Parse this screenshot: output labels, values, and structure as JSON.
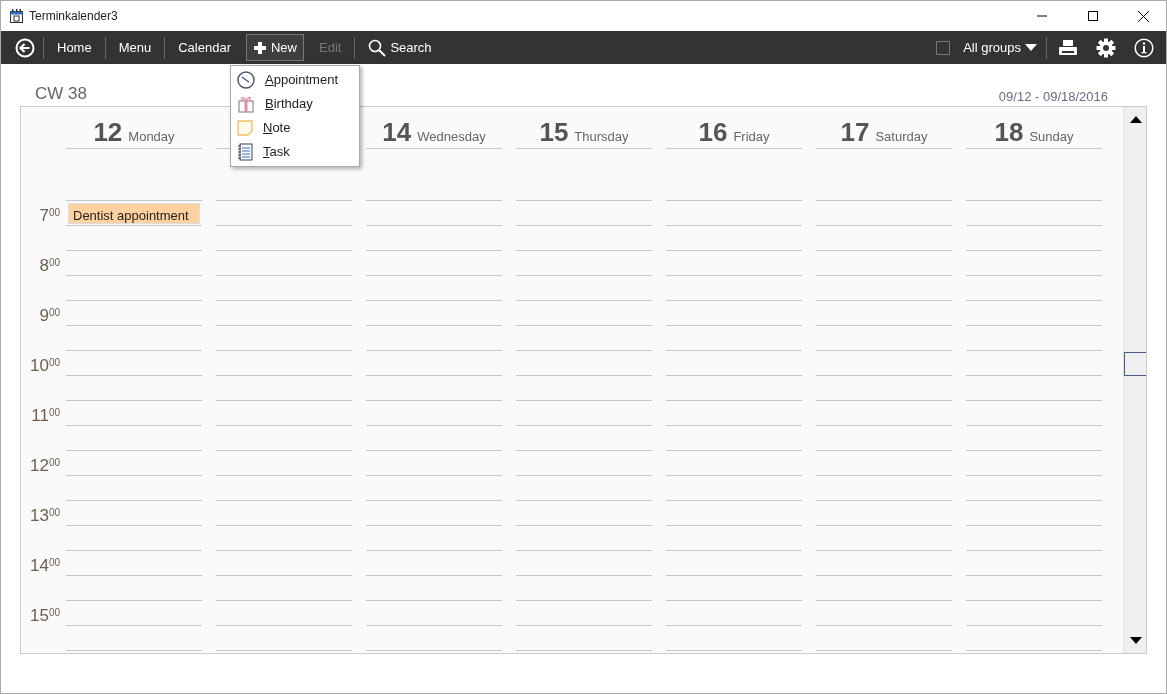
{
  "window": {
    "title": "Terminkalender3"
  },
  "toolbar": {
    "items": [
      {
        "kind": "nav",
        "label": "Home",
        "disabled": false,
        "selected": false
      },
      {
        "kind": "nav",
        "label": "Menu",
        "disabled": false,
        "selected": false
      },
      {
        "kind": "nav",
        "label": "Calendar",
        "disabled": false,
        "selected": false
      },
      {
        "kind": "new",
        "label": "New",
        "disabled": false,
        "selected": true
      },
      {
        "kind": "nav",
        "label": "Edit",
        "disabled": true,
        "selected": false
      },
      {
        "kind": "search",
        "label": "Search",
        "disabled": false,
        "selected": false
      }
    ],
    "groups": {
      "label": "All groups",
      "checked": false
    }
  },
  "new_menu": [
    {
      "kind": "appointment",
      "label": "Appointment"
    },
    {
      "kind": "birthday",
      "label": "Birthday"
    },
    {
      "kind": "note",
      "label": "Note"
    },
    {
      "kind": "task",
      "label": "Task"
    }
  ],
  "week_label": "CW 38",
  "date_range": "09/12 - 09/18/2016",
  "days": [
    {
      "kind": "day",
      "number": "12",
      "name": "Monday",
      "events": [
        {
          "title": "Dentist appointment",
          "color": "#ffd19e"
        }
      ]
    },
    {
      "kind": "covered"
    },
    {
      "kind": "day",
      "number": "14",
      "name": "Wednesday"
    },
    {
      "kind": "day",
      "number": "15",
      "name": "Thursday"
    },
    {
      "kind": "day",
      "number": "16",
      "name": "Friday"
    },
    {
      "kind": "day",
      "number": "17",
      "name": "Saturday"
    },
    {
      "kind": "day",
      "number": "18",
      "name": "Sunday"
    }
  ],
  "hours": [
    {
      "hour": "7",
      "minutes": "00"
    },
    {
      "hour": "8",
      "minutes": "00"
    },
    {
      "hour": "9",
      "minutes": "00"
    },
    {
      "hour": "10",
      "minutes": "00"
    },
    {
      "hour": "11",
      "minutes": "00"
    },
    {
      "hour": "12",
      "minutes": "00"
    },
    {
      "hour": "13",
      "minutes": "00"
    },
    {
      "hour": "14",
      "minutes": "00"
    },
    {
      "hour": "15",
      "minutes": "00"
    }
  ]
}
